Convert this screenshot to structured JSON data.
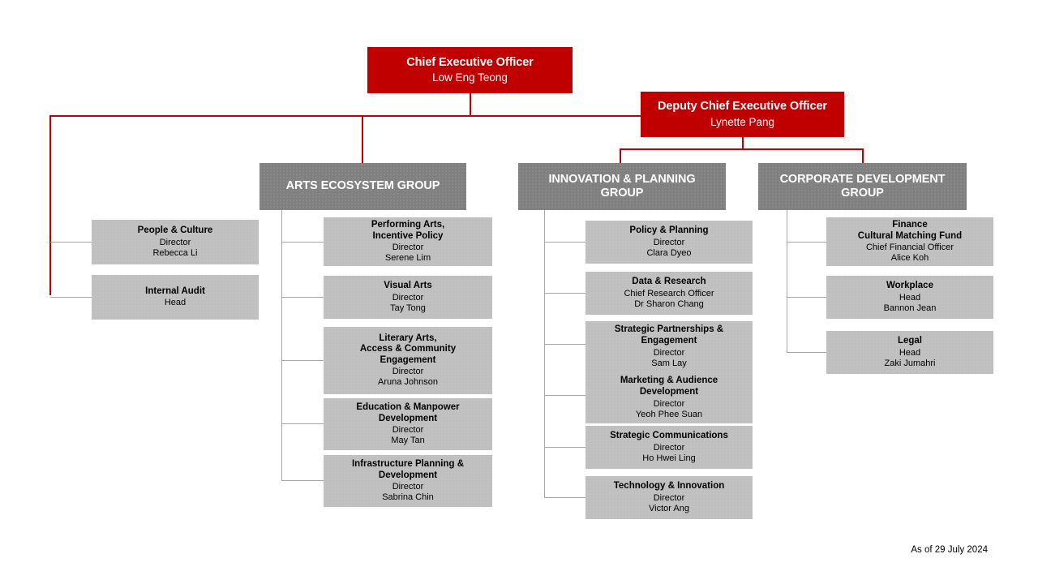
{
  "document": {
    "type": "organisation-chart",
    "footer_note": "As of 29 July 2024"
  },
  "executives": [
    {
      "id": "ceo",
      "title": "Chief Executive Officer",
      "person": "Low Eng Teong"
    },
    {
      "id": "dceo",
      "title": "Deputy Chief Executive Officer",
      "person": "Lynette Pang"
    }
  ],
  "direct_reports": [
    {
      "id": "people-culture",
      "title": "People & Culture",
      "role": "Director",
      "person": "Rebecca Li"
    },
    {
      "id": "internal-audit",
      "title": "Internal Audit",
      "role": "Head",
      "person": ""
    }
  ],
  "groups": [
    {
      "id": "arts-ecosystem-group",
      "name": "ARTS ECOSYSTEM GROUP",
      "divisions": [
        {
          "id": "performing-arts",
          "title": "Performing Arts,\nIncentive Policy",
          "role": "Director",
          "person": "Serene Lim"
        },
        {
          "id": "visual-arts",
          "title": "Visual Arts",
          "role": "Director",
          "person": "Tay Tong"
        },
        {
          "id": "literary-arts",
          "title": "Literary Arts,\nAccess & Community\nEngagement",
          "role": "Director",
          "person": "Aruna Johnson"
        },
        {
          "id": "education-manpower",
          "title": "Education & Manpower\nDevelopment",
          "role": "Director",
          "person": "May Tan"
        },
        {
          "id": "infrastructure-planning",
          "title": "Infrastructure Planning &\nDevelopment",
          "role": "Director",
          "person": "Sabrina Chin"
        }
      ]
    },
    {
      "id": "innovation-planning-group",
      "name": "INNOVATION & PLANNING\nGROUP",
      "divisions": [
        {
          "id": "policy-planning",
          "title": "Policy & Planning",
          "role": "Director",
          "person": "Clara  Dyeo"
        },
        {
          "id": "data-research",
          "title": "Data & Research",
          "role": "Chief Research Officer",
          "person": "Dr Sharon Chang"
        },
        {
          "id": "strategic-partnerships",
          "title": "Strategic Partnerships &\nEngagement",
          "role": "Director",
          "person": "Sam Lay"
        },
        {
          "id": "marketing-audience",
          "title": "Marketing & Audience\nDevelopment",
          "role": "Director",
          "person": "Yeoh Phee Suan"
        },
        {
          "id": "strategic-communications",
          "title": "Strategic Communications",
          "role": "Director",
          "person": "Ho Hwei Ling"
        },
        {
          "id": "technology-innovation",
          "title": "Technology & Innovation",
          "role": "Director",
          "person": "Victor Ang"
        }
      ]
    },
    {
      "id": "corporate-development-group",
      "name": "CORPORATE DEVELOPMENT\nGROUP",
      "divisions": [
        {
          "id": "finance-cmf",
          "title": "Finance\nCultural Matching Fund",
          "role": "Chief Financial  Officer",
          "person": "Alice Koh"
        },
        {
          "id": "workplace",
          "title": "Workplace",
          "role": "Head",
          "person": "Bannon Jean"
        },
        {
          "id": "legal",
          "title": "Legal",
          "role": "Head",
          "person": "Zaki Jumahri"
        }
      ]
    }
  ],
  "colors": {
    "executive": "#C00000",
    "group_header": "#808080",
    "division": "#BFBFBF",
    "connector_red": "#C00000",
    "connector_gray": "#A6A6A6"
  }
}
